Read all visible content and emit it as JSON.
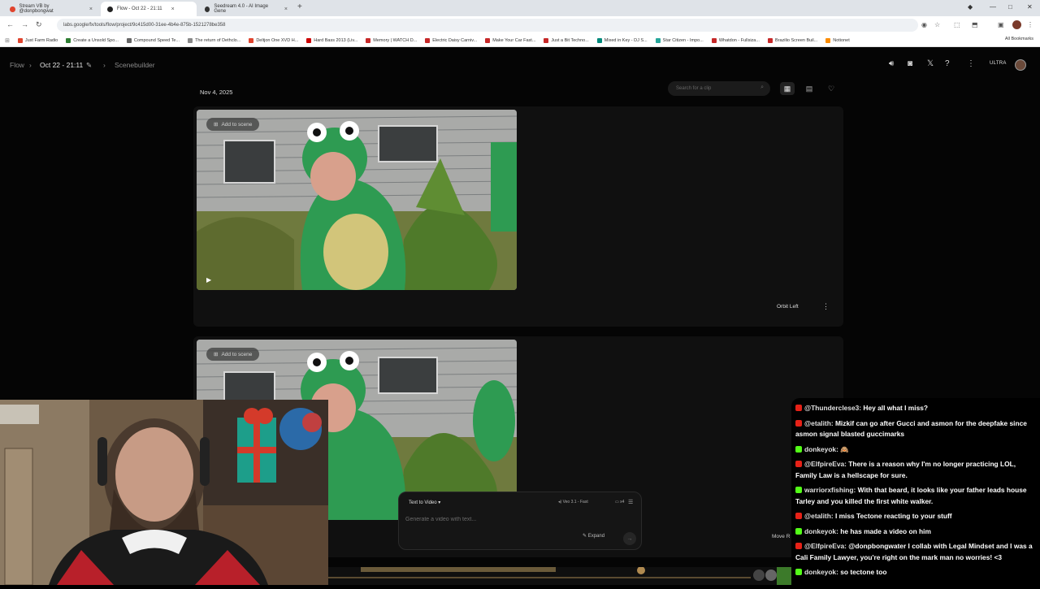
{
  "browser": {
    "tabs": [
      {
        "label": "Stream VB by @donpbongwat",
        "color": "#e0442e",
        "active": false
      },
      {
        "label": "Flow - Oct 22 - 21:11",
        "color": "#222222",
        "active": true
      },
      {
        "label": "Seedream 4.0 - AI Image Gene",
        "color": "#333333",
        "active": false
      }
    ],
    "new_tab": "+",
    "url": "labs.google/fx/tools/flow/project/9c415d00-31ee-4b4e-875b-1521278be358",
    "bookmarks": [
      {
        "label": "Just Farm Radio",
        "color": "#e0442e"
      },
      {
        "label": "Create a Unsold Spo...",
        "color": "#2e7d32"
      },
      {
        "label": "Compound Speed Te...",
        "color": "#666666"
      },
      {
        "label": "The return of Dethclo...",
        "color": "#888888"
      },
      {
        "label": "Deltjon One XVD H...",
        "color": "#e0442e"
      },
      {
        "label": "Hard Bass 2013 (Liv...",
        "color": "#cc0000"
      },
      {
        "label": "Memory | WATCH D...",
        "color": "#c62828"
      },
      {
        "label": "Electric Daisy Carniv...",
        "color": "#c62828"
      },
      {
        "label": "Make Your Car Fast...",
        "color": "#c62828"
      },
      {
        "label": "Just a Bit Techno...",
        "color": "#c62828"
      },
      {
        "label": "Mixed in Key - DJ S...",
        "color": "#00897b"
      },
      {
        "label": "Star Citizen - Impo...",
        "color": "#26a69a"
      },
      {
        "label": "Whatdon - Fullsiza...",
        "color": "#c62828"
      },
      {
        "label": "Brazilio Screen Buil...",
        "color": "#c62828"
      },
      {
        "label": "Notionet",
        "color": "#fb8c00"
      }
    ],
    "all_bookmarks": "All Bookmarks"
  },
  "header": {
    "crumbs": [
      "Flow",
      "Oct 22 - 21:11",
      "Scenebuilder"
    ],
    "badge": "ULTRA"
  },
  "toolbar": {
    "date": "Nov 4, 2025",
    "search_placeholder": "Search for a clip"
  },
  "clips": [
    {
      "add_label": "Add to scene",
      "camera": "Orbit Left"
    },
    {
      "add_label": "Add to scene",
      "camera": "Move R"
    }
  ],
  "composer": {
    "mode": "Text to Video",
    "model": "Veo 3.1 - Fast",
    "count": "x4",
    "placeholder": "Generate a video with text...",
    "expand": "Expand"
  },
  "chat": [
    {
      "platform": "yt",
      "user": "@Thunderclese3:",
      "text": "Hey all what I miss?"
    },
    {
      "platform": "yt",
      "user": "@etalith:",
      "text": "Mizkif can go after Gucci and asmon for the deepfake since asmon signal blasted guccimarks"
    },
    {
      "platform": "kick",
      "user": "donkeyok:",
      "text": "🙈"
    },
    {
      "platform": "yt",
      "user": "@ElfpireEva:",
      "text": "There is a reason why I'm no longer practicing LOL, Family Law is a hellscape for sure."
    },
    {
      "platform": "kick",
      "user": "warriorxfishing:",
      "text": "With that beard, it looks like your father leads house Tarley and you killed the first white walker."
    },
    {
      "platform": "yt",
      "user": "@etalith:",
      "text": "I miss Tectone reacting to your stuff"
    },
    {
      "platform": "kick",
      "user": "donkeyok:",
      "text": "he has made a video on him"
    },
    {
      "platform": "yt",
      "user": "@ElfpireEva:",
      "text": "@donpbongwater I collab with Legal Mindset and I was a Cali Family Lawyer, you're right on the mark man no worries! <3"
    },
    {
      "platform": "kick",
      "user": "donkeyok:",
      "text": "so tectone too"
    }
  ]
}
